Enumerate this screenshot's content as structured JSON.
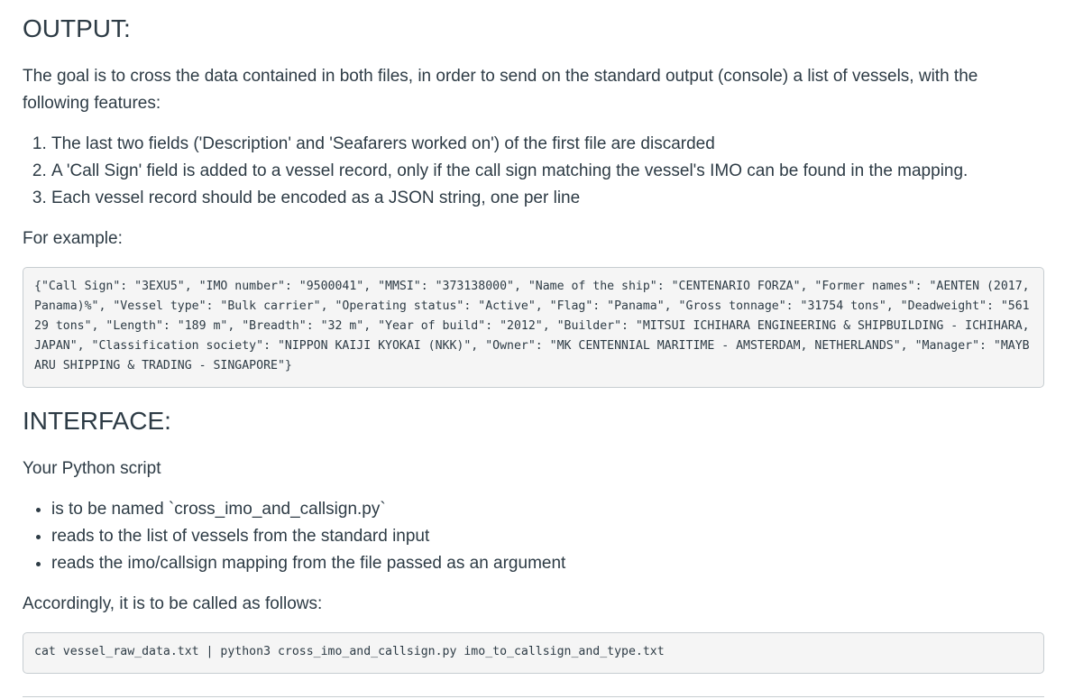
{
  "output_section": {
    "heading": "OUTPUT:",
    "goal_text": "The goal is to cross the data contained in both files, in order to send on the standard output (console) a list of vessels, with the following features:",
    "features": [
      "The last two fields ('Description' and 'Seafarers worked on') of the first file are discarded",
      "A 'Call Sign' field is added to a vessel record, only if the call sign matching the vessel's IMO can be found in the mapping.",
      "Each vessel record should be encoded as a JSON string, one per line"
    ],
    "for_example_label": "For example:",
    "example_code": "{\"Call Sign\": \"3EXU5\", \"IMO number\": \"9500041\", \"MMSI\": \"373138000\", \"Name of the ship\": \"CENTENARIO FORZA\", \"Former names\": \"AENTEN (2017, Panama)%\", \"Vessel type\": \"Bulk carrier\", \"Operating status\": \"Active\", \"Flag\": \"Panama\", \"Gross tonnage\": \"31754 tons\", \"Deadweight\": \"56129 tons\", \"Length\": \"189 m\", \"Breadth\": \"32 m\", \"Year of build\": \"2012\", \"Builder\": \"MITSUI ICHIHARA ENGINEERING & SHIPBUILDING - ICHIHARA, JAPAN\", \"Classification society\": \"NIPPON KAIJI KYOKAI (NKK)\", \"Owner\": \"MK CENTENNIAL MARITIME - AMSTERDAM, NETHERLANDS\", \"Manager\": \"MAYBARU SHIPPING & TRADING - SINGAPORE\"}"
  },
  "interface_section": {
    "heading": "INTERFACE:",
    "intro": "Your Python script",
    "items": [
      "is to be named `cross_imo_and_callsign.py`",
      "reads to the list of vessels from the standard input",
      "reads the imo/callsign mapping from the file passed as an argument"
    ],
    "accordingly_label": "Accordingly, it is to be called as follows:",
    "call_code": "cat vessel_raw_data.txt | python3 cross_imo_and_callsign.py imo_to_callsign_and_type.txt"
  }
}
